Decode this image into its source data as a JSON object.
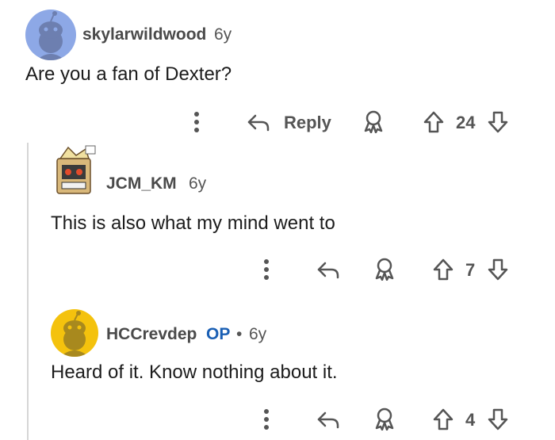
{
  "comments": [
    {
      "username": "skylarwildwood",
      "age": "6y",
      "text": "Are you a fan of Dexter?",
      "actions": {
        "reply_label": "Reply",
        "score": "24"
      }
    },
    {
      "username": "JCM_KM",
      "age": "6y",
      "text": "This is also what my mind went to",
      "actions": {
        "score": "7"
      }
    },
    {
      "username": "HCCrevdep",
      "op_badge": "OP",
      "separator": "•",
      "age": "6y",
      "text": "Heard of it. Know nothing about it.",
      "actions": {
        "score": "4"
      }
    }
  ],
  "colors": {
    "avatar1_bg": "#8da8e6",
    "avatar3_bg": "#f4c20d",
    "op_blue": "#1a5fb4",
    "icon_gray": "#555555"
  },
  "icons": [
    "more-icon",
    "reply-arrow-icon",
    "award-icon",
    "upvote-icon",
    "downvote-icon"
  ]
}
